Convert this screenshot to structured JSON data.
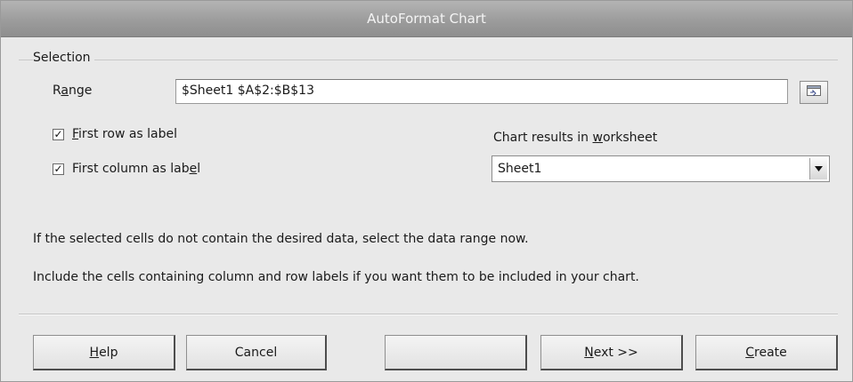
{
  "window": {
    "title": "AutoFormat Chart"
  },
  "selection": {
    "group_title": "Selection",
    "range_label": "Range",
    "range_value": "$Sheet1 $A$2:$B$13",
    "first_row_label": "First row as label",
    "first_row_checked": true,
    "first_column_label": "First column as label",
    "first_column_checked": true,
    "results_label": "Chart results in worksheet",
    "results_value": "Sheet1"
  },
  "info": {
    "line1": "If the selected cells do not contain the desired data, select the data range now.",
    "line2": "Include the cells containing column and row labels if you want them to be included in your chart."
  },
  "buttons": {
    "help": "Help",
    "cancel": "Cancel",
    "back": "",
    "next": "Next >>",
    "create": "Create"
  },
  "icons": {
    "shrink": "shrink-dialog-icon",
    "dropdown": "chevron-down-icon",
    "check": "checkmark-icon"
  }
}
